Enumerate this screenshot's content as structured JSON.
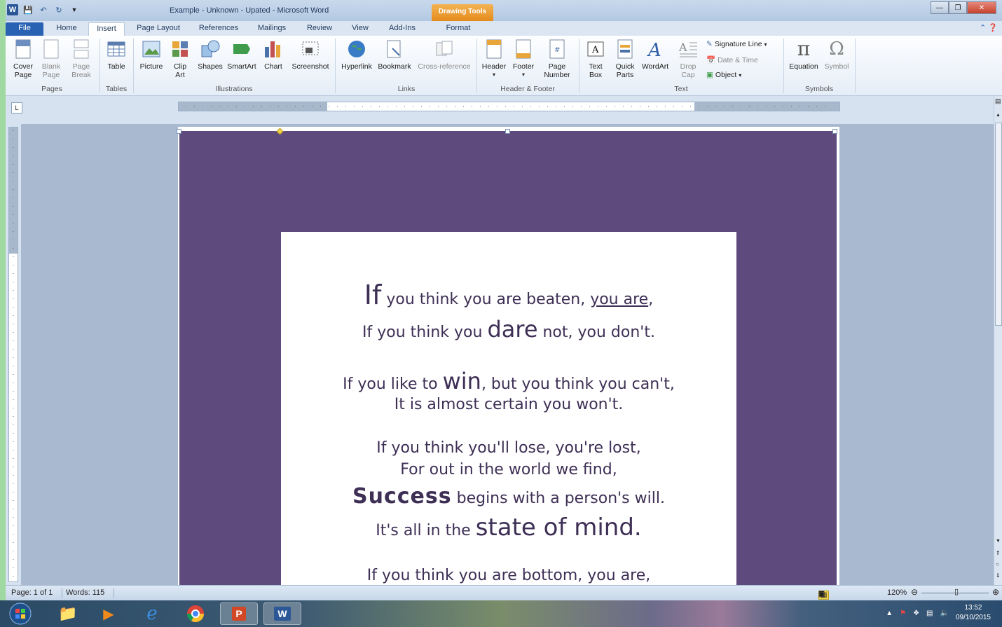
{
  "window": {
    "title": "Example - Unknown - Upated  -  Microsoft Word",
    "context_tab": "Drawing Tools"
  },
  "tabs": [
    "File",
    "Home",
    "Insert",
    "Page Layout",
    "References",
    "Mailings",
    "Review",
    "View",
    "Add-Ins",
    "Format"
  ],
  "ribbon": {
    "pages": {
      "cover_page": "Cover Page",
      "blank_page": "Blank Page",
      "page_break": "Page Break",
      "group": "Pages"
    },
    "tables": {
      "table": "Table",
      "group": "Tables"
    },
    "illustrations": {
      "picture": "Picture",
      "clip_art": "Clip Art",
      "shapes": "Shapes",
      "smartart": "SmartArt",
      "chart": "Chart",
      "screenshot": "Screenshot",
      "group": "Illustrations"
    },
    "links": {
      "hyperlink": "Hyperlink",
      "bookmark": "Bookmark",
      "cross_reference": "Cross-reference",
      "group": "Links"
    },
    "header_footer": {
      "header": "Header",
      "footer": "Footer",
      "page_number": "Page Number",
      "group": "Header & Footer"
    },
    "text": {
      "text_box": "Text Box",
      "quick_parts": "Quick Parts",
      "wordart": "WordArt",
      "drop_cap": "Drop Cap",
      "signature_line": "Signature Line",
      "date_time": "Date & Time",
      "object": "Object",
      "group": "Text"
    },
    "symbols": {
      "equation": "Equation",
      "symbol": "Symbol",
      "group": "Symbols"
    }
  },
  "document": {
    "poem": {
      "l1_a": "If",
      "l1_b": " you think you are beaten, ",
      "l1_c": "you are",
      "l1_d": ",",
      "l2_a": "If you think you ",
      "l2_b": "dare",
      "l2_c": " not, you don't.",
      "l3_a": "If you like to ",
      "l3_b": "win",
      "l3_c": ", but you think you can't,",
      "l4": "It is almost certain you won't.",
      "l5": "If you think you'll lose, you're lost,",
      "l6": "For out in the world we find,",
      "l7_a": "Success",
      "l7_b": " begins with a person's will.",
      "l8_a": "It's all in the ",
      "l8_b": "state of mind.",
      "l9": "If you think you are bottom, you are,"
    }
  },
  "status": {
    "page": "Page: 1 of 1",
    "words": "Words: 115",
    "zoom": "120%"
  },
  "taskbar": {
    "time": "13:52",
    "date": "09/10/2015"
  },
  "colors": {
    "purple_bg": "#5e4a7c",
    "text": "#3e2f55",
    "accent": "#2a62b3"
  }
}
